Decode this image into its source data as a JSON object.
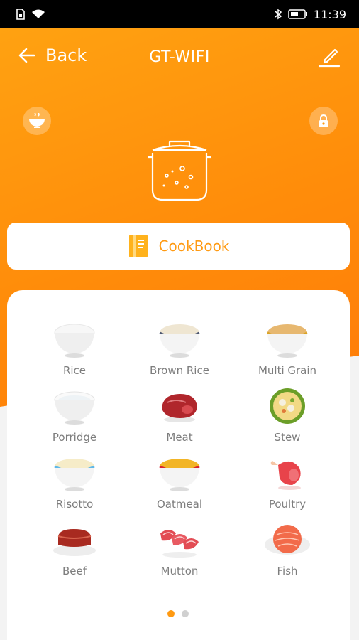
{
  "status_bar": {
    "time": "11:39"
  },
  "nav": {
    "back_label": "Back",
    "title": "GT-WIFI"
  },
  "cookbook": {
    "label": "CookBook"
  },
  "menu": [
    {
      "label": "Rice",
      "icon": "rice-bowl-icon"
    },
    {
      "label": "Brown Rice",
      "icon": "brown-rice-bowl-icon"
    },
    {
      "label": "Multi Grain",
      "icon": "multi-grain-bowl-icon"
    },
    {
      "label": "Porridge",
      "icon": "porridge-bowl-icon"
    },
    {
      "label": "Meat",
      "icon": "meat-icon"
    },
    {
      "label": "Stew",
      "icon": "stew-icon"
    },
    {
      "label": "Risotto",
      "icon": "risotto-bowl-icon"
    },
    {
      "label": "Oatmeal",
      "icon": "oatmeal-bowl-icon"
    },
    {
      "label": "Poultry",
      "icon": "poultry-icon"
    },
    {
      "label": "Beef",
      "icon": "beef-icon"
    },
    {
      "label": "Mutton",
      "icon": "mutton-icon"
    },
    {
      "label": "Fish",
      "icon": "fish-icon"
    }
  ],
  "pagination": {
    "pages": 2,
    "current": 1
  },
  "colors": {
    "accent": "#ff9a12",
    "header_orange": "#ff8c0a"
  }
}
